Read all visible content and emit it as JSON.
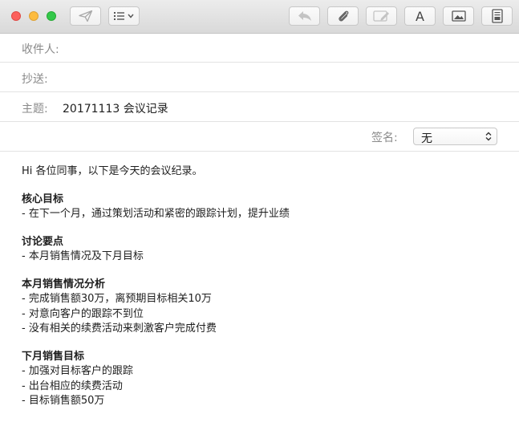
{
  "toolbar": {
    "buttons": [
      {
        "name": "send-button",
        "icon": "paper-plane-icon"
      },
      {
        "name": "list-format-button",
        "icon": "list-icon"
      },
      {
        "name": "reply-button",
        "icon": "reply-arrow-icon"
      },
      {
        "name": "attach-button",
        "icon": "paperclip-icon"
      },
      {
        "name": "markup-button",
        "icon": "markup-pen-icon"
      },
      {
        "name": "font-button",
        "icon": "font-a-icon",
        "label": "A"
      },
      {
        "name": "photo-browser-button",
        "icon": "photo-icon"
      },
      {
        "name": "template-button",
        "icon": "document-template-icon"
      }
    ]
  },
  "fields": {
    "to_label": "收件人:",
    "to_value": "",
    "cc_label": "抄送:",
    "cc_value": "",
    "subject_label": "主题:",
    "subject_value": "20171113 会议记录"
  },
  "signature": {
    "label": "签名:",
    "selected": "无"
  },
  "body": {
    "greeting": "Hi 各位同事，以下是今天的会议纪录。",
    "sections": [
      {
        "heading": "核心目标",
        "lines": [
          "- 在下一个月，通过策划活动和紧密的跟踪计划，提升业绩"
        ]
      },
      {
        "heading": "讨论要点",
        "lines": [
          "- 本月销售情况及下月目标"
        ]
      },
      {
        "heading": "本月销售情况分析",
        "lines": [
          "- 完成销售额30万，离预期目标相关10万",
          "- 对意向客户的跟踪不到位",
          "- 没有相关的续费活动来刺激客户完成付费"
        ]
      },
      {
        "heading": "下月销售目标",
        "lines": [
          "- 加强对目标客户的跟踪",
          "- 出台相应的续费活动",
          "- 目标销售额50万"
        ]
      }
    ]
  },
  "colors": {
    "close": "#fc605c",
    "minimize": "#fdbc40",
    "zoom": "#34c84a",
    "label_gray": "#8a8a8a",
    "text": "#1e1e1e"
  }
}
